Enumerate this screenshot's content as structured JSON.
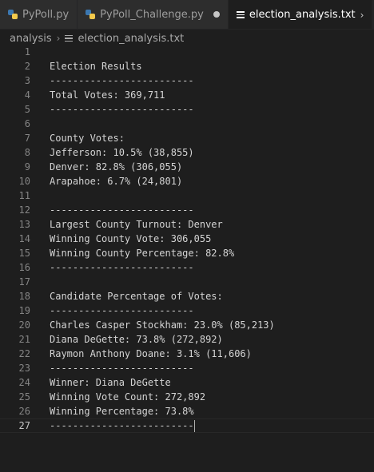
{
  "tabs": [
    {
      "label": "PyPoll.py",
      "icon": "python-icon",
      "modified": false,
      "active": false
    },
    {
      "label": "PyPoll_Challenge.py",
      "icon": "python-icon",
      "modified": true,
      "active": false
    },
    {
      "label": "election_analysis.txt",
      "icon": "text-file-icon",
      "modified": false,
      "active": true
    }
  ],
  "breadcrumb": {
    "folder": "analysis",
    "file": "election_analysis.txt"
  },
  "editor": {
    "current_line": 27,
    "lines": [
      {
        "num": "1",
        "text": ""
      },
      {
        "num": "2",
        "text": "Election Results"
      },
      {
        "num": "3",
        "text": "-------------------------"
      },
      {
        "num": "4",
        "text": "Total Votes: 369,711"
      },
      {
        "num": "5",
        "text": "-------------------------"
      },
      {
        "num": "6",
        "text": ""
      },
      {
        "num": "7",
        "text": "County Votes:"
      },
      {
        "num": "8",
        "text": "Jefferson: 10.5% (38,855)"
      },
      {
        "num": "9",
        "text": "Denver: 82.8% (306,055)"
      },
      {
        "num": "10",
        "text": "Arapahoe: 6.7% (24,801)"
      },
      {
        "num": "11",
        "text": ""
      },
      {
        "num": "12",
        "text": "-------------------------"
      },
      {
        "num": "13",
        "text": "Largest County Turnout: Denver"
      },
      {
        "num": "14",
        "text": "Winning County Vote: 306,055"
      },
      {
        "num": "15",
        "text": "Winning County Percentage: 82.8%"
      },
      {
        "num": "16",
        "text": "-------------------------"
      },
      {
        "num": "17",
        "text": ""
      },
      {
        "num": "18",
        "text": "Candidate Percentage of Votes:"
      },
      {
        "num": "19",
        "text": "-------------------------"
      },
      {
        "num": "20",
        "text": "Charles Casper Stockham: 23.0% (85,213)"
      },
      {
        "num": "21",
        "text": "Diana DeGette: 73.8% (272,892)"
      },
      {
        "num": "22",
        "text": "Raymon Anthony Doane: 3.1% (11,606)"
      },
      {
        "num": "23",
        "text": "-------------------------"
      },
      {
        "num": "24",
        "text": "Winner: Diana DeGette"
      },
      {
        "num": "25",
        "text": "Winning Vote Count: 272,892"
      },
      {
        "num": "26",
        "text": "Winning Percentage: 73.8%"
      },
      {
        "num": "27",
        "text": "-------------------------"
      }
    ]
  },
  "colors": {
    "background": "#1e1e1e",
    "tabbar": "#252526",
    "text": "#d4d4d4",
    "line_numbers": "#858585"
  }
}
